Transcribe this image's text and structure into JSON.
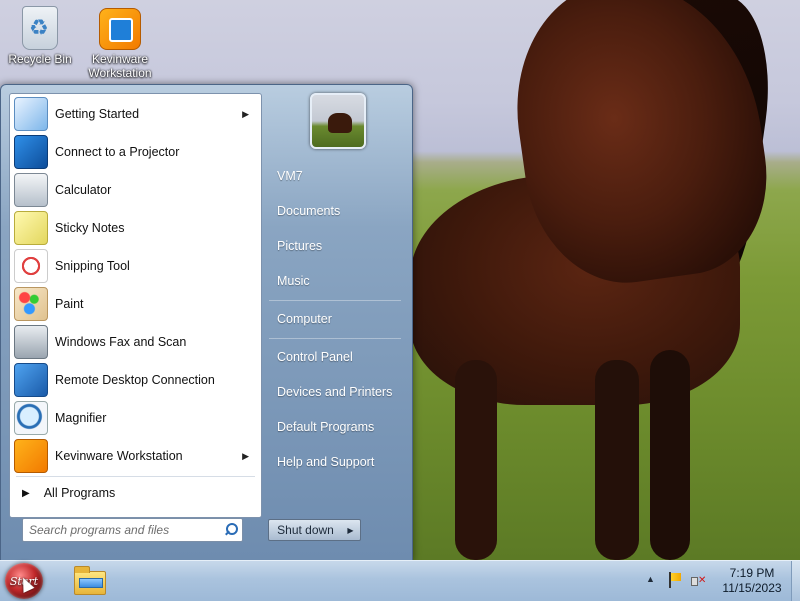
{
  "desktop": {
    "icons": [
      {
        "label": "Recycle Bin",
        "icon": "recycle-bin-icon"
      },
      {
        "label": "Kevinware Workstation",
        "icon": "kevinware-icon"
      }
    ]
  },
  "start_menu": {
    "programs": [
      {
        "label": "Getting Started",
        "icon": "getting-started-icon",
        "has_submenu": true
      },
      {
        "label": "Connect to a Projector",
        "icon": "projector-icon"
      },
      {
        "label": "Calculator",
        "icon": "calculator-icon"
      },
      {
        "label": "Sticky Notes",
        "icon": "sticky-notes-icon"
      },
      {
        "label": "Snipping Tool",
        "icon": "snipping-tool-icon"
      },
      {
        "label": "Paint",
        "icon": "paint-icon"
      },
      {
        "label": "Windows Fax and Scan",
        "icon": "fax-scan-icon"
      },
      {
        "label": "Remote Desktop Connection",
        "icon": "remote-desktop-icon"
      },
      {
        "label": "Magnifier",
        "icon": "magnifier-icon"
      },
      {
        "label": "Kevinware Workstation",
        "icon": "kevinware-icon",
        "has_submenu": true
      }
    ],
    "all_programs": "All Programs",
    "search": {
      "placeholder": "Search programs and files"
    },
    "right_links": [
      "VM7",
      "Documents",
      "Pictures",
      "Music",
      "Computer",
      "Control Panel",
      "Devices and Printers",
      "Default Programs",
      "Help and Support"
    ],
    "shutdown": {
      "label": "Shut down",
      "arrow": "▶"
    }
  },
  "taskbar": {
    "start_label": "Start",
    "tray_arrow": "▲",
    "clock": {
      "time": "7:19 PM",
      "date": "11/15/2023"
    }
  }
}
